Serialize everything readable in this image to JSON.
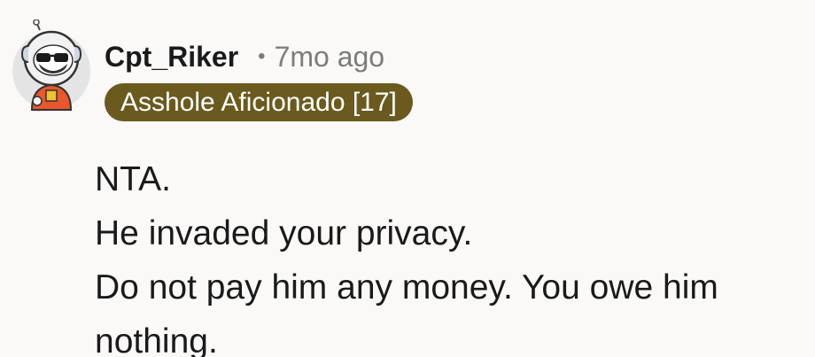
{
  "comment": {
    "author": "Cpt_Riker",
    "separator": "•",
    "timestamp": "7mo ago",
    "flair": "Asshole Aficionado [17]",
    "lines": [
      "NTA.",
      "He invaded your privacy.",
      "Do not pay him any money. You owe him nothing."
    ]
  },
  "avatar": {
    "icon": "snoo-astronaut-avatar-icon"
  },
  "colors": {
    "background": "#fbf9f8",
    "flair_bg": "#6b5a1e",
    "flair_text": "#ffffff",
    "meta_text": "#7c7c7c"
  }
}
